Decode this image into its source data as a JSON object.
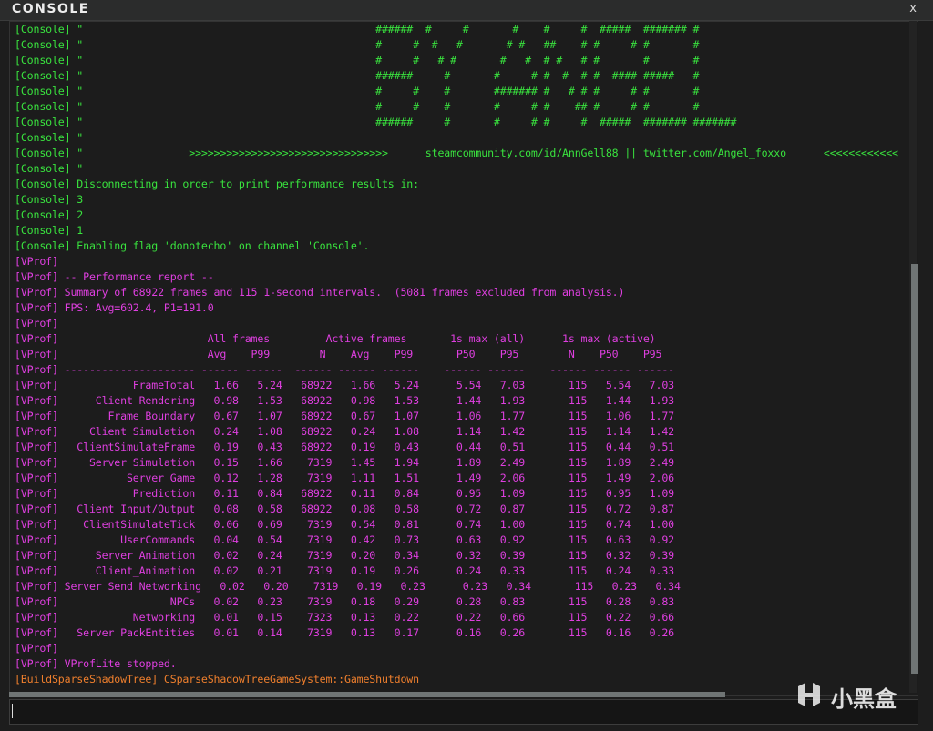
{
  "window": {
    "title": "CONSOLE",
    "close_label": "x"
  },
  "watermark": {
    "text": "小黑盒"
  },
  "input": {
    "value": ""
  },
  "colors": {
    "console": "#39e23e",
    "vprof": "#df3fe0",
    "shadow": "#ef7f2d"
  },
  "lines": [
    {
      "c": "green",
      "t": "[Console] \"                                               ######  #     #       #    #     #  #####  ####### #"
    },
    {
      "c": "green",
      "t": "[Console] \"                                               #     #  #   #       # #   ##    # #     # #       #"
    },
    {
      "c": "green",
      "t": "[Console] \"                                               #     #   # #       #   #  # #   # #       #       #"
    },
    {
      "c": "green",
      "t": "[Console] \"                                               ######     #       #     # #  #  # #  #### #####   #"
    },
    {
      "c": "green",
      "t": "[Console] \"                                               #     #    #       ####### #   # # #     # #       #"
    },
    {
      "c": "green",
      "t": "[Console] \"                                               #     #    #       #     # #    ## #     # #       #"
    },
    {
      "c": "green",
      "t": "[Console] \"                                               ######     #       #     # #     #  #####  ####### #######"
    },
    {
      "c": "green",
      "t": "[Console] \""
    },
    {
      "c": "green",
      "t": "[Console] \"                 >>>>>>>>>>>>>>>>>>>>>>>>>>>>>>>>      steamcommunity.com/id/AnnGell88 || twitter.com/Angel_foxxo      <<<<<<<<<<<<"
    },
    {
      "c": "green",
      "t": "[Console] \""
    },
    {
      "c": "green",
      "t": "[Console] Disconnecting in order to print performance results in:"
    },
    {
      "c": "green",
      "t": "[Console] 3"
    },
    {
      "c": "green",
      "t": "[Console] 2"
    },
    {
      "c": "green",
      "t": "[Console] 1"
    },
    {
      "c": "green",
      "t": "[Console] Enabling flag 'donotecho' on channel 'Console'."
    },
    {
      "c": "mag",
      "t": "[VProf]"
    },
    {
      "c": "mag",
      "t": "[VProf] -- Performance report --"
    },
    {
      "c": "mag",
      "t": "[VProf] Summary of 68922 frames and 115 1-second intervals.  (5081 frames excluded from analysis.)"
    },
    {
      "c": "mag",
      "t": "[VProf] FPS: Avg=602.4, P1=191.0"
    },
    {
      "c": "mag",
      "t": "[VProf]"
    },
    {
      "c": "mag",
      "t": "[VProf]                        All frames         Active frames       1s max (all)      1s max (active)"
    },
    {
      "c": "mag",
      "t": "[VProf]                        Avg    P99        N    Avg    P99       P50    P95        N    P50    P95"
    },
    {
      "c": "mag",
      "t": "[VProf] --------------------- ------ ------  ------ ------ ------    ------ ------    ------ ------ ------"
    },
    {
      "c": "mag",
      "t": "[VProf]            FrameTotal   1.66   5.24   68922   1.66   5.24      5.54   7.03       115   5.54   7.03"
    },
    {
      "c": "mag",
      "t": "[VProf]      Client Rendering   0.98   1.53   68922   0.98   1.53      1.44   1.93       115   1.44   1.93"
    },
    {
      "c": "mag",
      "t": "[VProf]        Frame Boundary   0.67   1.07   68922   0.67   1.07      1.06   1.77       115   1.06   1.77"
    },
    {
      "c": "mag",
      "t": "[VProf]     Client Simulation   0.24   1.08   68922   0.24   1.08      1.14   1.42       115   1.14   1.42"
    },
    {
      "c": "mag",
      "t": "[VProf]   ClientSimulateFrame   0.19   0.43   68922   0.19   0.43      0.44   0.51       115   0.44   0.51"
    },
    {
      "c": "mag",
      "t": "[VProf]     Server Simulation   0.15   1.66    7319   1.45   1.94      1.89   2.49       115   1.89   2.49"
    },
    {
      "c": "mag",
      "t": "[VProf]           Server Game   0.12   1.28    7319   1.11   1.51      1.49   2.06       115   1.49   2.06"
    },
    {
      "c": "mag",
      "t": "[VProf]            Prediction   0.11   0.84   68922   0.11   0.84      0.95   1.09       115   0.95   1.09"
    },
    {
      "c": "mag",
      "t": "[VProf]   Client Input/Output   0.08   0.58   68922   0.08   0.58      0.72   0.87       115   0.72   0.87"
    },
    {
      "c": "mag",
      "t": "[VProf]    ClientSimulateTick   0.06   0.69    7319   0.54   0.81      0.74   1.00       115   0.74   1.00"
    },
    {
      "c": "mag",
      "t": "[VProf]          UserCommands   0.04   0.54    7319   0.42   0.73      0.63   0.92       115   0.63   0.92"
    },
    {
      "c": "mag",
      "t": "[VProf]      Server Animation   0.02   0.24    7319   0.20   0.34      0.32   0.39       115   0.32   0.39"
    },
    {
      "c": "mag",
      "t": "[VProf]      Client_Animation   0.02   0.21    7319   0.19   0.26      0.24   0.33       115   0.24   0.33"
    },
    {
      "c": "mag",
      "t": "[VProf] Server Send Networking   0.02   0.20    7319   0.19   0.23      0.23   0.34       115   0.23   0.34"
    },
    {
      "c": "mag",
      "t": "[VProf]                  NPCs   0.02   0.23    7319   0.18   0.29      0.28   0.83       115   0.28   0.83"
    },
    {
      "c": "mag",
      "t": "[VProf]            Networking   0.01   0.15    7323   0.13   0.22      0.22   0.66       115   0.22   0.66"
    },
    {
      "c": "mag",
      "t": "[VProf]   Server PackEntities   0.01   0.14    7319   0.13   0.17      0.16   0.26       115   0.16   0.26"
    },
    {
      "c": "mag",
      "t": "[VProf]"
    },
    {
      "c": "mag",
      "t": "[VProf] VProfLite stopped."
    },
    {
      "c": "orange",
      "t": "[BuildSparseShadowTree] CSparseShadowTreeGameSystem::GameShutdown"
    }
  ]
}
